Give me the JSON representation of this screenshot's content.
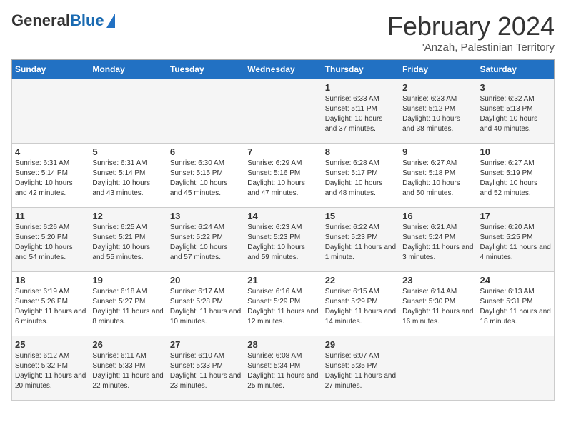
{
  "header": {
    "logo_general": "General",
    "logo_blue": "Blue",
    "month": "February 2024",
    "location": "'Anzah, Palestinian Territory"
  },
  "weekdays": [
    "Sunday",
    "Monday",
    "Tuesday",
    "Wednesday",
    "Thursday",
    "Friday",
    "Saturday"
  ],
  "weeks": [
    [
      {
        "day": "",
        "info": ""
      },
      {
        "day": "",
        "info": ""
      },
      {
        "day": "",
        "info": ""
      },
      {
        "day": "",
        "info": ""
      },
      {
        "day": "1",
        "info": "Sunrise: 6:33 AM\nSunset: 5:11 PM\nDaylight: 10 hours and 37 minutes."
      },
      {
        "day": "2",
        "info": "Sunrise: 6:33 AM\nSunset: 5:12 PM\nDaylight: 10 hours and 38 minutes."
      },
      {
        "day": "3",
        "info": "Sunrise: 6:32 AM\nSunset: 5:13 PM\nDaylight: 10 hours and 40 minutes."
      }
    ],
    [
      {
        "day": "4",
        "info": "Sunrise: 6:31 AM\nSunset: 5:14 PM\nDaylight: 10 hours and 42 minutes."
      },
      {
        "day": "5",
        "info": "Sunrise: 6:31 AM\nSunset: 5:14 PM\nDaylight: 10 hours and 43 minutes."
      },
      {
        "day": "6",
        "info": "Sunrise: 6:30 AM\nSunset: 5:15 PM\nDaylight: 10 hours and 45 minutes."
      },
      {
        "day": "7",
        "info": "Sunrise: 6:29 AM\nSunset: 5:16 PM\nDaylight: 10 hours and 47 minutes."
      },
      {
        "day": "8",
        "info": "Sunrise: 6:28 AM\nSunset: 5:17 PM\nDaylight: 10 hours and 48 minutes."
      },
      {
        "day": "9",
        "info": "Sunrise: 6:27 AM\nSunset: 5:18 PM\nDaylight: 10 hours and 50 minutes."
      },
      {
        "day": "10",
        "info": "Sunrise: 6:27 AM\nSunset: 5:19 PM\nDaylight: 10 hours and 52 minutes."
      }
    ],
    [
      {
        "day": "11",
        "info": "Sunrise: 6:26 AM\nSunset: 5:20 PM\nDaylight: 10 hours and 54 minutes."
      },
      {
        "day": "12",
        "info": "Sunrise: 6:25 AM\nSunset: 5:21 PM\nDaylight: 10 hours and 55 minutes."
      },
      {
        "day": "13",
        "info": "Sunrise: 6:24 AM\nSunset: 5:22 PM\nDaylight: 10 hours and 57 minutes."
      },
      {
        "day": "14",
        "info": "Sunrise: 6:23 AM\nSunset: 5:23 PM\nDaylight: 10 hours and 59 minutes."
      },
      {
        "day": "15",
        "info": "Sunrise: 6:22 AM\nSunset: 5:23 PM\nDaylight: 11 hours and 1 minute."
      },
      {
        "day": "16",
        "info": "Sunrise: 6:21 AM\nSunset: 5:24 PM\nDaylight: 11 hours and 3 minutes."
      },
      {
        "day": "17",
        "info": "Sunrise: 6:20 AM\nSunset: 5:25 PM\nDaylight: 11 hours and 4 minutes."
      }
    ],
    [
      {
        "day": "18",
        "info": "Sunrise: 6:19 AM\nSunset: 5:26 PM\nDaylight: 11 hours and 6 minutes."
      },
      {
        "day": "19",
        "info": "Sunrise: 6:18 AM\nSunset: 5:27 PM\nDaylight: 11 hours and 8 minutes."
      },
      {
        "day": "20",
        "info": "Sunrise: 6:17 AM\nSunset: 5:28 PM\nDaylight: 11 hours and 10 minutes."
      },
      {
        "day": "21",
        "info": "Sunrise: 6:16 AM\nSunset: 5:29 PM\nDaylight: 11 hours and 12 minutes."
      },
      {
        "day": "22",
        "info": "Sunrise: 6:15 AM\nSunset: 5:29 PM\nDaylight: 11 hours and 14 minutes."
      },
      {
        "day": "23",
        "info": "Sunrise: 6:14 AM\nSunset: 5:30 PM\nDaylight: 11 hours and 16 minutes."
      },
      {
        "day": "24",
        "info": "Sunrise: 6:13 AM\nSunset: 5:31 PM\nDaylight: 11 hours and 18 minutes."
      }
    ],
    [
      {
        "day": "25",
        "info": "Sunrise: 6:12 AM\nSunset: 5:32 PM\nDaylight: 11 hours and 20 minutes."
      },
      {
        "day": "26",
        "info": "Sunrise: 6:11 AM\nSunset: 5:33 PM\nDaylight: 11 hours and 22 minutes."
      },
      {
        "day": "27",
        "info": "Sunrise: 6:10 AM\nSunset: 5:33 PM\nDaylight: 11 hours and 23 minutes."
      },
      {
        "day": "28",
        "info": "Sunrise: 6:08 AM\nSunset: 5:34 PM\nDaylight: 11 hours and 25 minutes."
      },
      {
        "day": "29",
        "info": "Sunrise: 6:07 AM\nSunset: 5:35 PM\nDaylight: 11 hours and 27 minutes."
      },
      {
        "day": "",
        "info": ""
      },
      {
        "day": "",
        "info": ""
      }
    ]
  ]
}
